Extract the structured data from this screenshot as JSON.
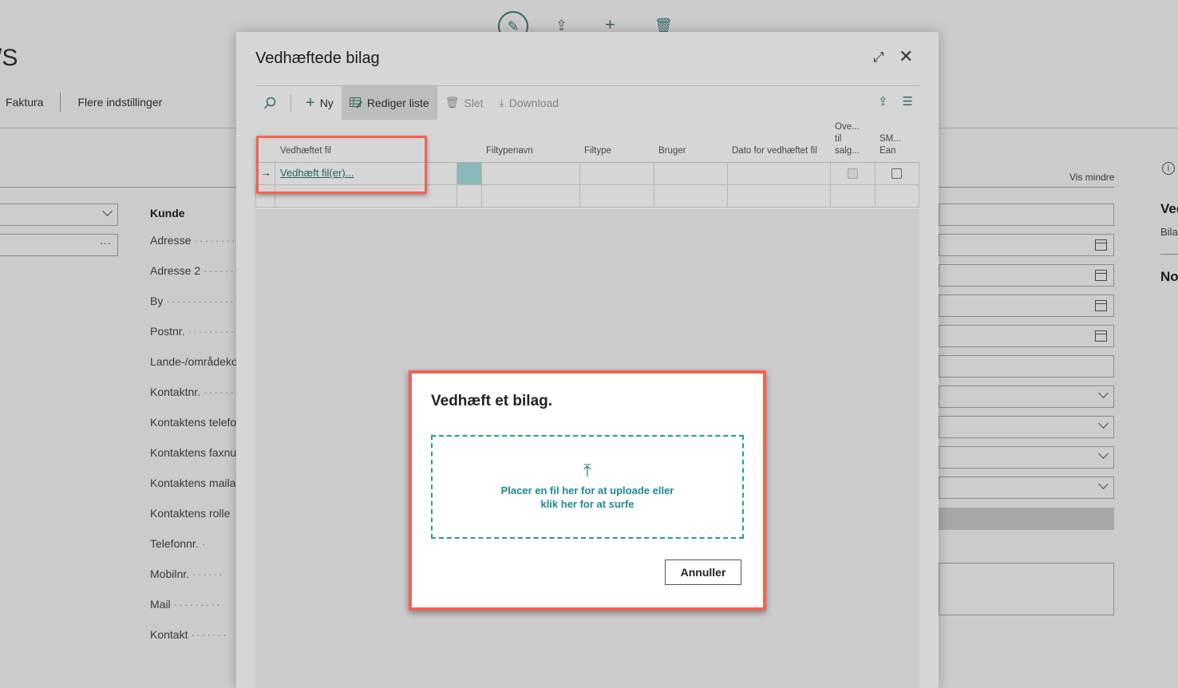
{
  "background": {
    "page_title": "/S",
    "actions": [
      "Faktura",
      "Flere indstillinger"
    ],
    "customer_section_title": "Kunde",
    "fields": [
      "Adresse",
      "Adresse 2",
      "By",
      "Postnr.",
      "Lande-/områdekode",
      "Kontaktnr.",
      "Kontaktens telefonnr.",
      "Kontaktens faxnummer",
      "Kontaktens mailadresse",
      "Kontaktens rolle",
      "Telefonnr.",
      "Mobilnr.",
      "Mail",
      "Kontakt"
    ],
    "show_less": "Vis mindre",
    "factbox_title": "Ved",
    "factbox_subtitle": "Bila",
    "factbox_notes": "No"
  },
  "dialog": {
    "title": "Vedhæftede bilag",
    "toolbar": {
      "new_label": "Ny",
      "edit_list_label": "Rediger liste",
      "delete_label": "Slet",
      "download_label": "Download"
    },
    "columns": [
      "Vedhæftet fil",
      "Filtypenavn",
      "Filtype",
      "Bruger",
      "Dato for vedhæftet fil",
      "Ove... til salg...",
      "SM... Ean"
    ],
    "row": {
      "link": "Vedhæft fil(er)..."
    }
  },
  "upload_dialog": {
    "title": "Vedhæft et bilag.",
    "drop_text": "Placer en fil her for at uploade eller klik her for at surfe",
    "cancel_label": "Annuller"
  },
  "colors": {
    "accent": "#1f9ba0",
    "highlight": "#f06454",
    "link": "#2a7b7b"
  }
}
